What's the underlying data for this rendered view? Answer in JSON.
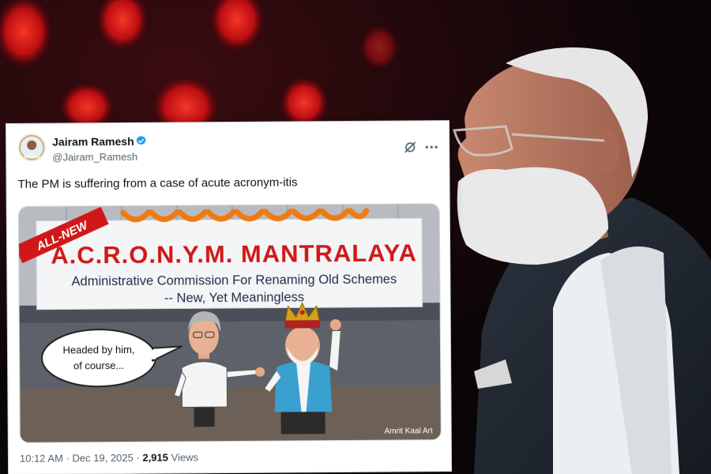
{
  "tweet": {
    "author_name": "Jairam Ramesh",
    "author_handle": "@Jairam_Ramesh",
    "text": "The PM is suffering from a case of acute acronym-itis",
    "time": "10:12 AM",
    "separator": "·",
    "date": "Dec 19, 2025",
    "views_count": "2,915",
    "views_label": "Views"
  },
  "cartoon": {
    "badge": "ALL-NEW",
    "title": "A.C.R.O.N.Y.M. MANTRALAYA",
    "subtitle_line1": "Administrative Commission For Renaming  Old Schemes",
    "subtitle_line2": "-- New, Yet Meaningless",
    "speech_line1": "Headed by him,",
    "speech_line2": "of course...",
    "credit": "Amrit Kaal Art"
  },
  "colors": {
    "verified_blue": "#1d9bf0",
    "title_red": "#d01818",
    "acronym_red": "#c62828",
    "marigold": "#f07a12",
    "backdrop_red": "#e11818"
  },
  "icons": [
    "verified-icon",
    "grok-icon",
    "more-icon"
  ]
}
